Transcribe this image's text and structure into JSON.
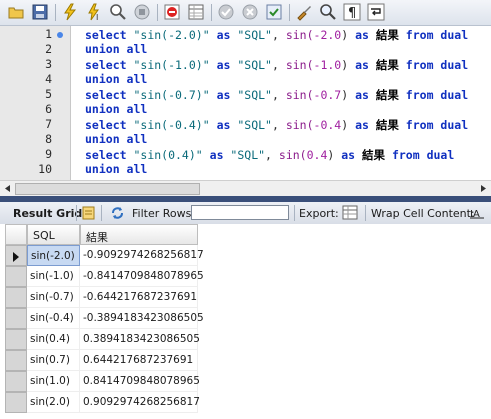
{
  "toolbar": {
    "buttons": [
      {
        "icon": "open-folder-icon"
      },
      {
        "icon": "save-icon"
      },
      {
        "icon": "execute-lightning-icon"
      },
      {
        "icon": "execute-current-icon"
      },
      {
        "icon": "explain-magnifier-icon"
      },
      {
        "icon": "stop-hand-icon"
      },
      {
        "icon": "toggle-stop-on-error-icon"
      },
      {
        "icon": "toggle-result-panel-icon"
      },
      {
        "icon": "commit-check-icon"
      },
      {
        "icon": "rollback-x-icon"
      },
      {
        "icon": "autocommit-toggle-icon"
      },
      {
        "icon": "beautify-brush-icon"
      },
      {
        "icon": "find-magnifier-icon"
      },
      {
        "icon": "invisible-chars-pilcrow-icon"
      },
      {
        "icon": "word-wrap-icon"
      }
    ]
  },
  "editor": {
    "line_numbers": [
      "1",
      "2",
      "3",
      "4",
      "5",
      "6",
      "7",
      "8",
      "9",
      "10"
    ],
    "lines": [
      [
        {
          "t": "select ",
          "c": "kw"
        },
        {
          "t": "\"sin(-2.0)\"",
          "c": "str"
        },
        {
          "t": " as ",
          "c": "kw"
        },
        {
          "t": "\"SQL\"",
          "c": "str"
        },
        {
          "t": ", ",
          "c": ""
        },
        {
          "t": "sin(",
          "c": "fn"
        },
        {
          "t": "-2.0",
          "c": "num"
        },
        {
          "t": ")",
          "c": ""
        },
        {
          "t": " as ",
          "c": "kw"
        },
        {
          "t": "結果",
          "c": "cjk"
        },
        {
          "t": " from ",
          "c": "kw"
        },
        {
          "t": "dual",
          "c": "kw"
        }
      ],
      [
        {
          "t": "union all",
          "c": "kw"
        }
      ],
      [
        {
          "t": "select ",
          "c": "kw"
        },
        {
          "t": "\"sin(-1.0)\"",
          "c": "str"
        },
        {
          "t": " as ",
          "c": "kw"
        },
        {
          "t": "\"SQL\"",
          "c": "str"
        },
        {
          "t": ", ",
          "c": ""
        },
        {
          "t": "sin(",
          "c": "fn"
        },
        {
          "t": "-1.0",
          "c": "num"
        },
        {
          "t": ")",
          "c": ""
        },
        {
          "t": " as ",
          "c": "kw"
        },
        {
          "t": "結果",
          "c": "cjk"
        },
        {
          "t": " from ",
          "c": "kw"
        },
        {
          "t": "dual",
          "c": "kw"
        }
      ],
      [
        {
          "t": "union all",
          "c": "kw"
        }
      ],
      [
        {
          "t": "select ",
          "c": "kw"
        },
        {
          "t": "\"sin(-0.7)\"",
          "c": "str"
        },
        {
          "t": " as ",
          "c": "kw"
        },
        {
          "t": "\"SQL\"",
          "c": "str"
        },
        {
          "t": ", ",
          "c": ""
        },
        {
          "t": "sin(",
          "c": "fn"
        },
        {
          "t": "-0.7",
          "c": "num"
        },
        {
          "t": ")",
          "c": ""
        },
        {
          "t": " as ",
          "c": "kw"
        },
        {
          "t": "結果",
          "c": "cjk"
        },
        {
          "t": " from ",
          "c": "kw"
        },
        {
          "t": "dual",
          "c": "kw"
        }
      ],
      [
        {
          "t": "union all",
          "c": "kw"
        }
      ],
      [
        {
          "t": "select ",
          "c": "kw"
        },
        {
          "t": "\"sin(-0.4)\"",
          "c": "str"
        },
        {
          "t": " as ",
          "c": "kw"
        },
        {
          "t": "\"SQL\"",
          "c": "str"
        },
        {
          "t": ", ",
          "c": ""
        },
        {
          "t": "sin(",
          "c": "fn"
        },
        {
          "t": "-0.4",
          "c": "num"
        },
        {
          "t": ")",
          "c": ""
        },
        {
          "t": " as ",
          "c": "kw"
        },
        {
          "t": "結果",
          "c": "cjk"
        },
        {
          "t": " from ",
          "c": "kw"
        },
        {
          "t": "dual",
          "c": "kw"
        }
      ],
      [
        {
          "t": "union all",
          "c": "kw"
        }
      ],
      [
        {
          "t": "select ",
          "c": "kw"
        },
        {
          "t": "\"sin(0.4)\"",
          "c": "str"
        },
        {
          "t": " as ",
          "c": "kw"
        },
        {
          "t": "\"SQL\"",
          "c": "str"
        },
        {
          "t": ", ",
          "c": ""
        },
        {
          "t": "sin(",
          "c": "fn"
        },
        {
          "t": "0.4",
          "c": "num"
        },
        {
          "t": ")",
          "c": ""
        },
        {
          "t": " as ",
          "c": "kw"
        },
        {
          "t": "結果",
          "c": "cjk"
        },
        {
          "t": " from ",
          "c": "kw"
        },
        {
          "t": "dual",
          "c": "kw"
        }
      ],
      [
        {
          "t": "union all",
          "c": "kw"
        }
      ]
    ],
    "colors": {
      "keyword": "#1030c0",
      "string": "#0a6a7a",
      "number": "#a020a0",
      "function": "#8a1a8a"
    }
  },
  "results_toolbar": {
    "result_grid_label": "Result Grid",
    "filter_rows_label": "Filter Rows:",
    "filter_rows_value": "",
    "export_label": "Export:",
    "wrap_label": "Wrap Cell Content:"
  },
  "grid": {
    "columns": [
      "SQL",
      "結果"
    ],
    "rows": [
      [
        "sin(-2.0)",
        "-0.9092974268256817"
      ],
      [
        "sin(-1.0)",
        "-0.8414709848078965"
      ],
      [
        "sin(-0.7)",
        "-0.644217687237691"
      ],
      [
        "sin(-0.4)",
        "-0.3894183423086505"
      ],
      [
        "sin(0.4)",
        "0.3894183423086505"
      ],
      [
        "sin(0.7)",
        "0.644217687237691"
      ],
      [
        "sin(1.0)",
        "0.8414709848078965"
      ],
      [
        "sin(2.0)",
        "0.9092974268256817"
      ]
    ],
    "selected_row": 0
  }
}
